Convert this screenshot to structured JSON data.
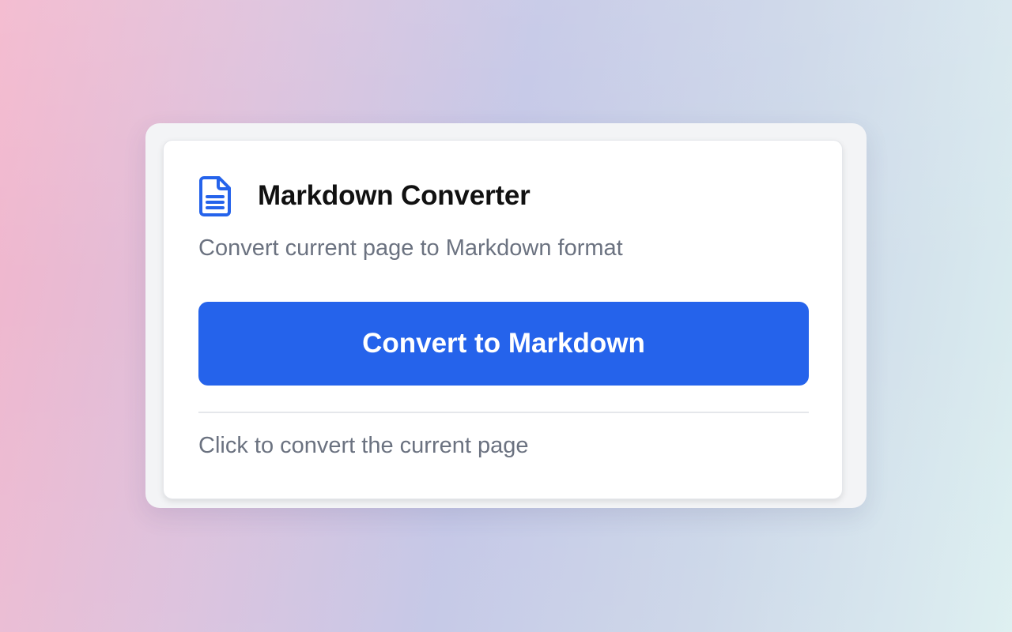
{
  "popup": {
    "title": "Markdown Converter",
    "subtitle": "Convert current page to Markdown format",
    "convert_button_label": "Convert to Markdown",
    "status_text": "Click to convert the current page",
    "header_icon": "document-icon"
  },
  "colors": {
    "accent": "#2563eb",
    "title_text": "#111111",
    "muted_text": "#6b7280",
    "card_background": "#ffffff",
    "frame_background": "#f3f4f6",
    "divider": "#e5e7eb"
  }
}
